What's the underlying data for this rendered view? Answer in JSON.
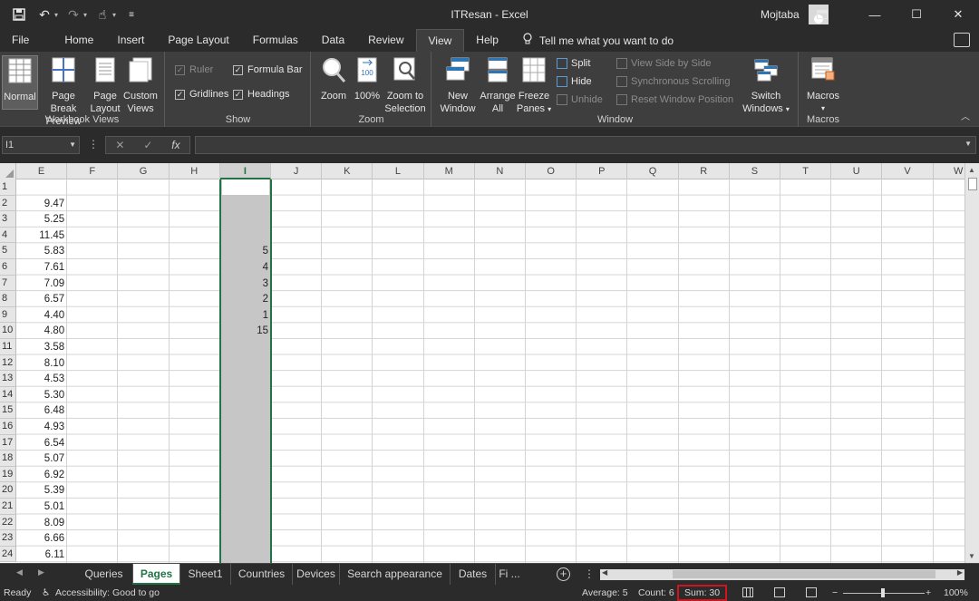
{
  "window": {
    "title": "ITResan  -  Excel",
    "user_name": "Mojtaba"
  },
  "tabs": [
    "File",
    "Home",
    "Insert",
    "Page Layout",
    "Formulas",
    "Data",
    "Review",
    "View",
    "Help"
  ],
  "active_tab": "View",
  "tell_me": "Tell me what you want to do",
  "ribbon": {
    "workbook_views": {
      "label": "Workbook Views",
      "normal": "Normal",
      "page_break_1": "Page Break",
      "page_break_2": "Preview",
      "page_layout_1": "Page",
      "page_layout_2": "Layout",
      "custom_1": "Custom",
      "custom_2": "Views"
    },
    "show": {
      "label": "Show",
      "ruler": "Ruler",
      "formula_bar": "Formula Bar",
      "gridlines": "Gridlines",
      "headings": "Headings"
    },
    "zoom": {
      "label": "Zoom",
      "zoom": "Zoom",
      "hundred": "100%",
      "sel_1": "Zoom to",
      "sel_2": "Selection"
    },
    "window": {
      "label": "Window",
      "new_1": "New",
      "new_2": "Window",
      "arrange_1": "Arrange",
      "arrange_2": "All",
      "freeze_1": "Freeze",
      "freeze_2": "Panes",
      "split": "Split",
      "hide": "Hide",
      "unhide": "Unhide",
      "side_by_side": "View Side by Side",
      "sync_scroll": "Synchronous Scrolling",
      "reset_pos": "Reset Window Position",
      "switch_1": "Switch",
      "switch_2": "Windows"
    },
    "macros": {
      "label": "Macros",
      "macros": "Macros"
    }
  },
  "formula_bar": {
    "name_box": "I1",
    "fx": "fx",
    "value": ""
  },
  "columns": [
    "E",
    "F",
    "G",
    "H",
    "I",
    "J",
    "K",
    "L",
    "M",
    "N",
    "O",
    "P",
    "Q",
    "R",
    "S",
    "T",
    "U",
    "V",
    "W"
  ],
  "selected_column": "I",
  "rows": [
    "1",
    "2",
    "3",
    "4",
    "5",
    "6",
    "7",
    "8",
    "9",
    "10",
    "11",
    "12",
    "13",
    "14",
    "15",
    "16",
    "17",
    "18",
    "19",
    "20",
    "21",
    "22",
    "23",
    "24"
  ],
  "column_e_values": [
    "",
    "9.47",
    "5.25",
    "11.45",
    "5.83",
    "7.61",
    "7.09",
    "6.57",
    "4.40",
    "4.80",
    "3.58",
    "8.10",
    "4.53",
    "5.30",
    "6.48",
    "4.93",
    "6.54",
    "5.07",
    "6.92",
    "5.39",
    "5.01",
    "8.09",
    "6.66",
    "6.11"
  ],
  "column_i_values": [
    "",
    "",
    "",
    "",
    "5",
    "4",
    "3",
    "2",
    "1",
    "15",
    "",
    "",
    "",
    "",
    "",
    "",
    "",
    "",
    "",
    "",
    "",
    "",
    "",
    ""
  ],
  "sheets": [
    "Queries",
    "Pages",
    "Sheet1",
    "Countries",
    "Devices",
    "Search appearance",
    "Dates",
    "Fi ..."
  ],
  "active_sheet": "Pages",
  "status": {
    "ready": "Ready",
    "accessibility": "Accessibility: Good to go",
    "average": "Average: 5",
    "count": "Count: 6",
    "sum": "Sum: 30",
    "zoom": "100%"
  },
  "colors": {
    "accent_green": "#217346",
    "sum_highlight": "#d0141e"
  }
}
